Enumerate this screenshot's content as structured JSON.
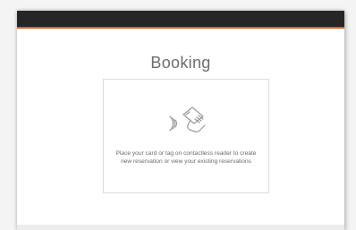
{
  "header": {
    "bar_color": "#262626",
    "accent_color": "#c46a38"
  },
  "main": {
    "title": "Booking",
    "card": {
      "icon": "contactless-card-icon",
      "instruction": "Place your card or tag on contactless reader to create new reservation or view your existing reservations"
    }
  }
}
